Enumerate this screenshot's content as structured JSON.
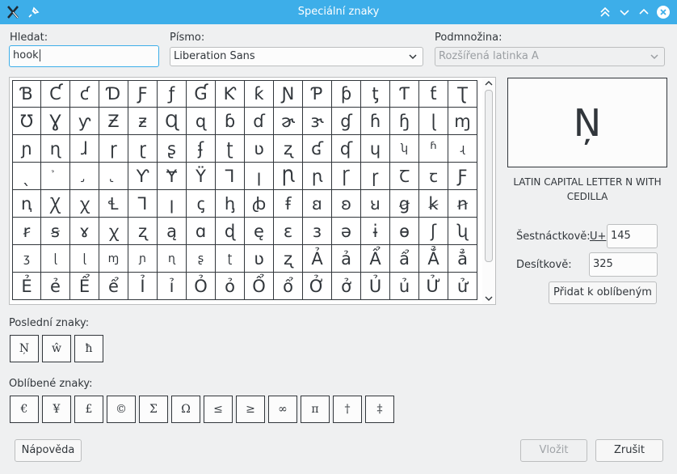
{
  "window": {
    "title": "Speciální znaky",
    "icons": [
      "app-icon",
      "pin-icon",
      "keep-above-icon",
      "minimize-icon",
      "maximize-icon",
      "close-icon"
    ]
  },
  "search": {
    "label": "Hledat:",
    "value": "hook"
  },
  "font": {
    "label": "Písmo:",
    "value": "Liberation Sans"
  },
  "subset": {
    "label": "Podmnožina:",
    "value": "Rozšířená latinka A"
  },
  "grid": {
    "chars": [
      "Ɓ",
      "Ƈ",
      "ƈ",
      "Ɗ",
      "Ƒ",
      "ƒ",
      "Ɠ",
      "Ƙ",
      "ƙ",
      "Ɲ",
      "Ƥ",
      "ƥ",
      "ƫ",
      "Ƭ",
      "ƭ",
      "Ʈ",
      "Ʊ",
      "Ɣ",
      "ƴ",
      "Ƶ",
      "ƶ",
      "Ɋ",
      "ɋ",
      "ɓ",
      "ɗ",
      "ɚ",
      "ɝ",
      "ɠ",
      "ɦ",
      "ɧ",
      "ɭ",
      "ɱ",
      "ɲ",
      "ɳ",
      "ɺ",
      "ɼ",
      "ɽ",
      "ʂ",
      "ʄ",
      "ʈ",
      "ʋ",
      "ʐ",
      "ʛ",
      "ʠ",
      "ɥ",
      "ʮ",
      "ʱ",
      "ɻ",
      "ˎ",
      "̉",
      "̡",
      "̢",
      "Ƴ",
      "Ɏ",
      "Ÿ",
      "Ꞁ",
      "ꞁ",
      "Ꞃ",
      "ꞃ",
      "Ꞅ",
      "ꞅ",
      "Ꞇ",
      "ꞇ",
      "Ƒ",
      "ꞑ",
      "Ꭓ",
      "ꭓ",
      "Ɬ",
      "Ꞁ",
      "ꞁ",
      "ꞔ",
      "ꞕ",
      "ꞗ",
      "ꞙ",
      "ꞛ",
      "ꞝ",
      "ꞟ",
      "ꞡ",
      "ꞣ",
      "ꞥ",
      "ꞧ",
      "ꞩ",
      "ɤ",
      "ꭓ",
      "ʐ",
      "ą",
      "ɑ",
      "ɖ",
      "ę",
      "ɛ",
      "ɜ",
      "ə",
      "ɨ",
      "ɵ",
      "ʃ",
      "ʯ",
      "ʒ",
      "ɭ",
      "ɭ",
      "ɱ",
      "ɲ",
      "ɳ",
      "ʂ",
      "ʈ",
      "ʋ",
      "ʐ",
      "Ả",
      "ả",
      "Ẩ",
      "ẩ",
      "Ẳ",
      "ẳ",
      "Ẻ",
      "ẻ",
      "Ể",
      "ể",
      "Ỉ",
      "ỉ",
      "Ỏ",
      "ỏ",
      "Ổ",
      "ổ",
      "Ở",
      "ở",
      "Ủ",
      "ủ",
      "Ử",
      "ử"
    ],
    "small_cells": [
      45,
      47,
      49,
      50,
      51,
      96,
      97,
      98,
      99,
      100,
      101,
      102,
      103
    ]
  },
  "preview": {
    "char": "Ņ",
    "name": "LATIN CAPITAL LETTER N WITH CEDILLA"
  },
  "hex": {
    "label": "Šestnáctkově:",
    "prefix": "U+",
    "value": "145"
  },
  "dec": {
    "label": "Desítkově:",
    "value": "325"
  },
  "add_fav_label": "Přidat k oblíbeným",
  "recent": {
    "label": "Poslední znaky:",
    "chars": [
      "Ņ",
      "ŵ",
      "ħ"
    ]
  },
  "favorites": {
    "label": "Oblíbené znaky:",
    "chars": [
      "€",
      "¥",
      "£",
      "©",
      "Σ",
      "Ω",
      "≤",
      "≥",
      "∞",
      "π",
      "†",
      "‡"
    ]
  },
  "buttons": {
    "help": "Nápověda",
    "insert": "Vložit",
    "cancel": "Zrušit"
  },
  "colors": {
    "titlebar": "#3daee9",
    "window": "#eff0f1",
    "text": "#31363b"
  }
}
